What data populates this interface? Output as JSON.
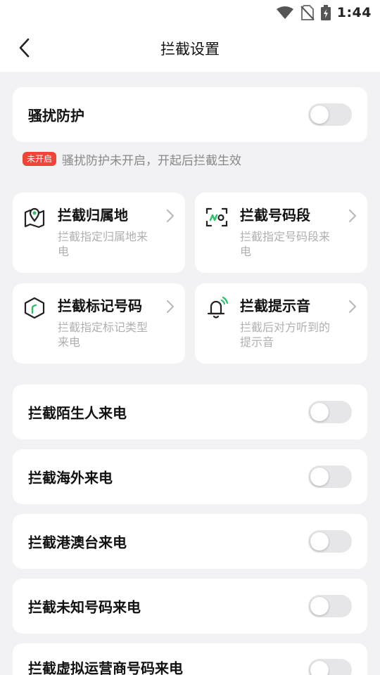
{
  "status": {
    "time": "1:44"
  },
  "header": {
    "title": "拦截设置"
  },
  "harass": {
    "label": "骚扰防护",
    "badge": "未开启",
    "notice": "骚扰防护未开启，开起后拦截生效"
  },
  "tiles": [
    {
      "title": "拦截归属地",
      "desc": "拦截指定归属地来电",
      "icon": "location-map-icon"
    },
    {
      "title": "拦截号码段",
      "desc": "拦截指定号码段来电",
      "icon": "number-scan-icon"
    },
    {
      "title": "拦截标记号码",
      "desc": "拦截指定标记类型来电",
      "icon": "tag-box-icon"
    },
    {
      "title": "拦截提示音",
      "desc": "拦截后对方听到的提示音",
      "icon": "bell-ring-icon"
    }
  ],
  "toggles": [
    {
      "label": "拦截陌生人来电"
    },
    {
      "label": "拦截海外来电"
    },
    {
      "label": "拦截港澳台来电"
    },
    {
      "label": "拦截未知号码来电"
    },
    {
      "label": "拦截虚拟运营商号码来电"
    }
  ],
  "colors": {
    "accent": "#2fbf6b",
    "badge": "#f04438",
    "background": "#f2f2f4"
  }
}
